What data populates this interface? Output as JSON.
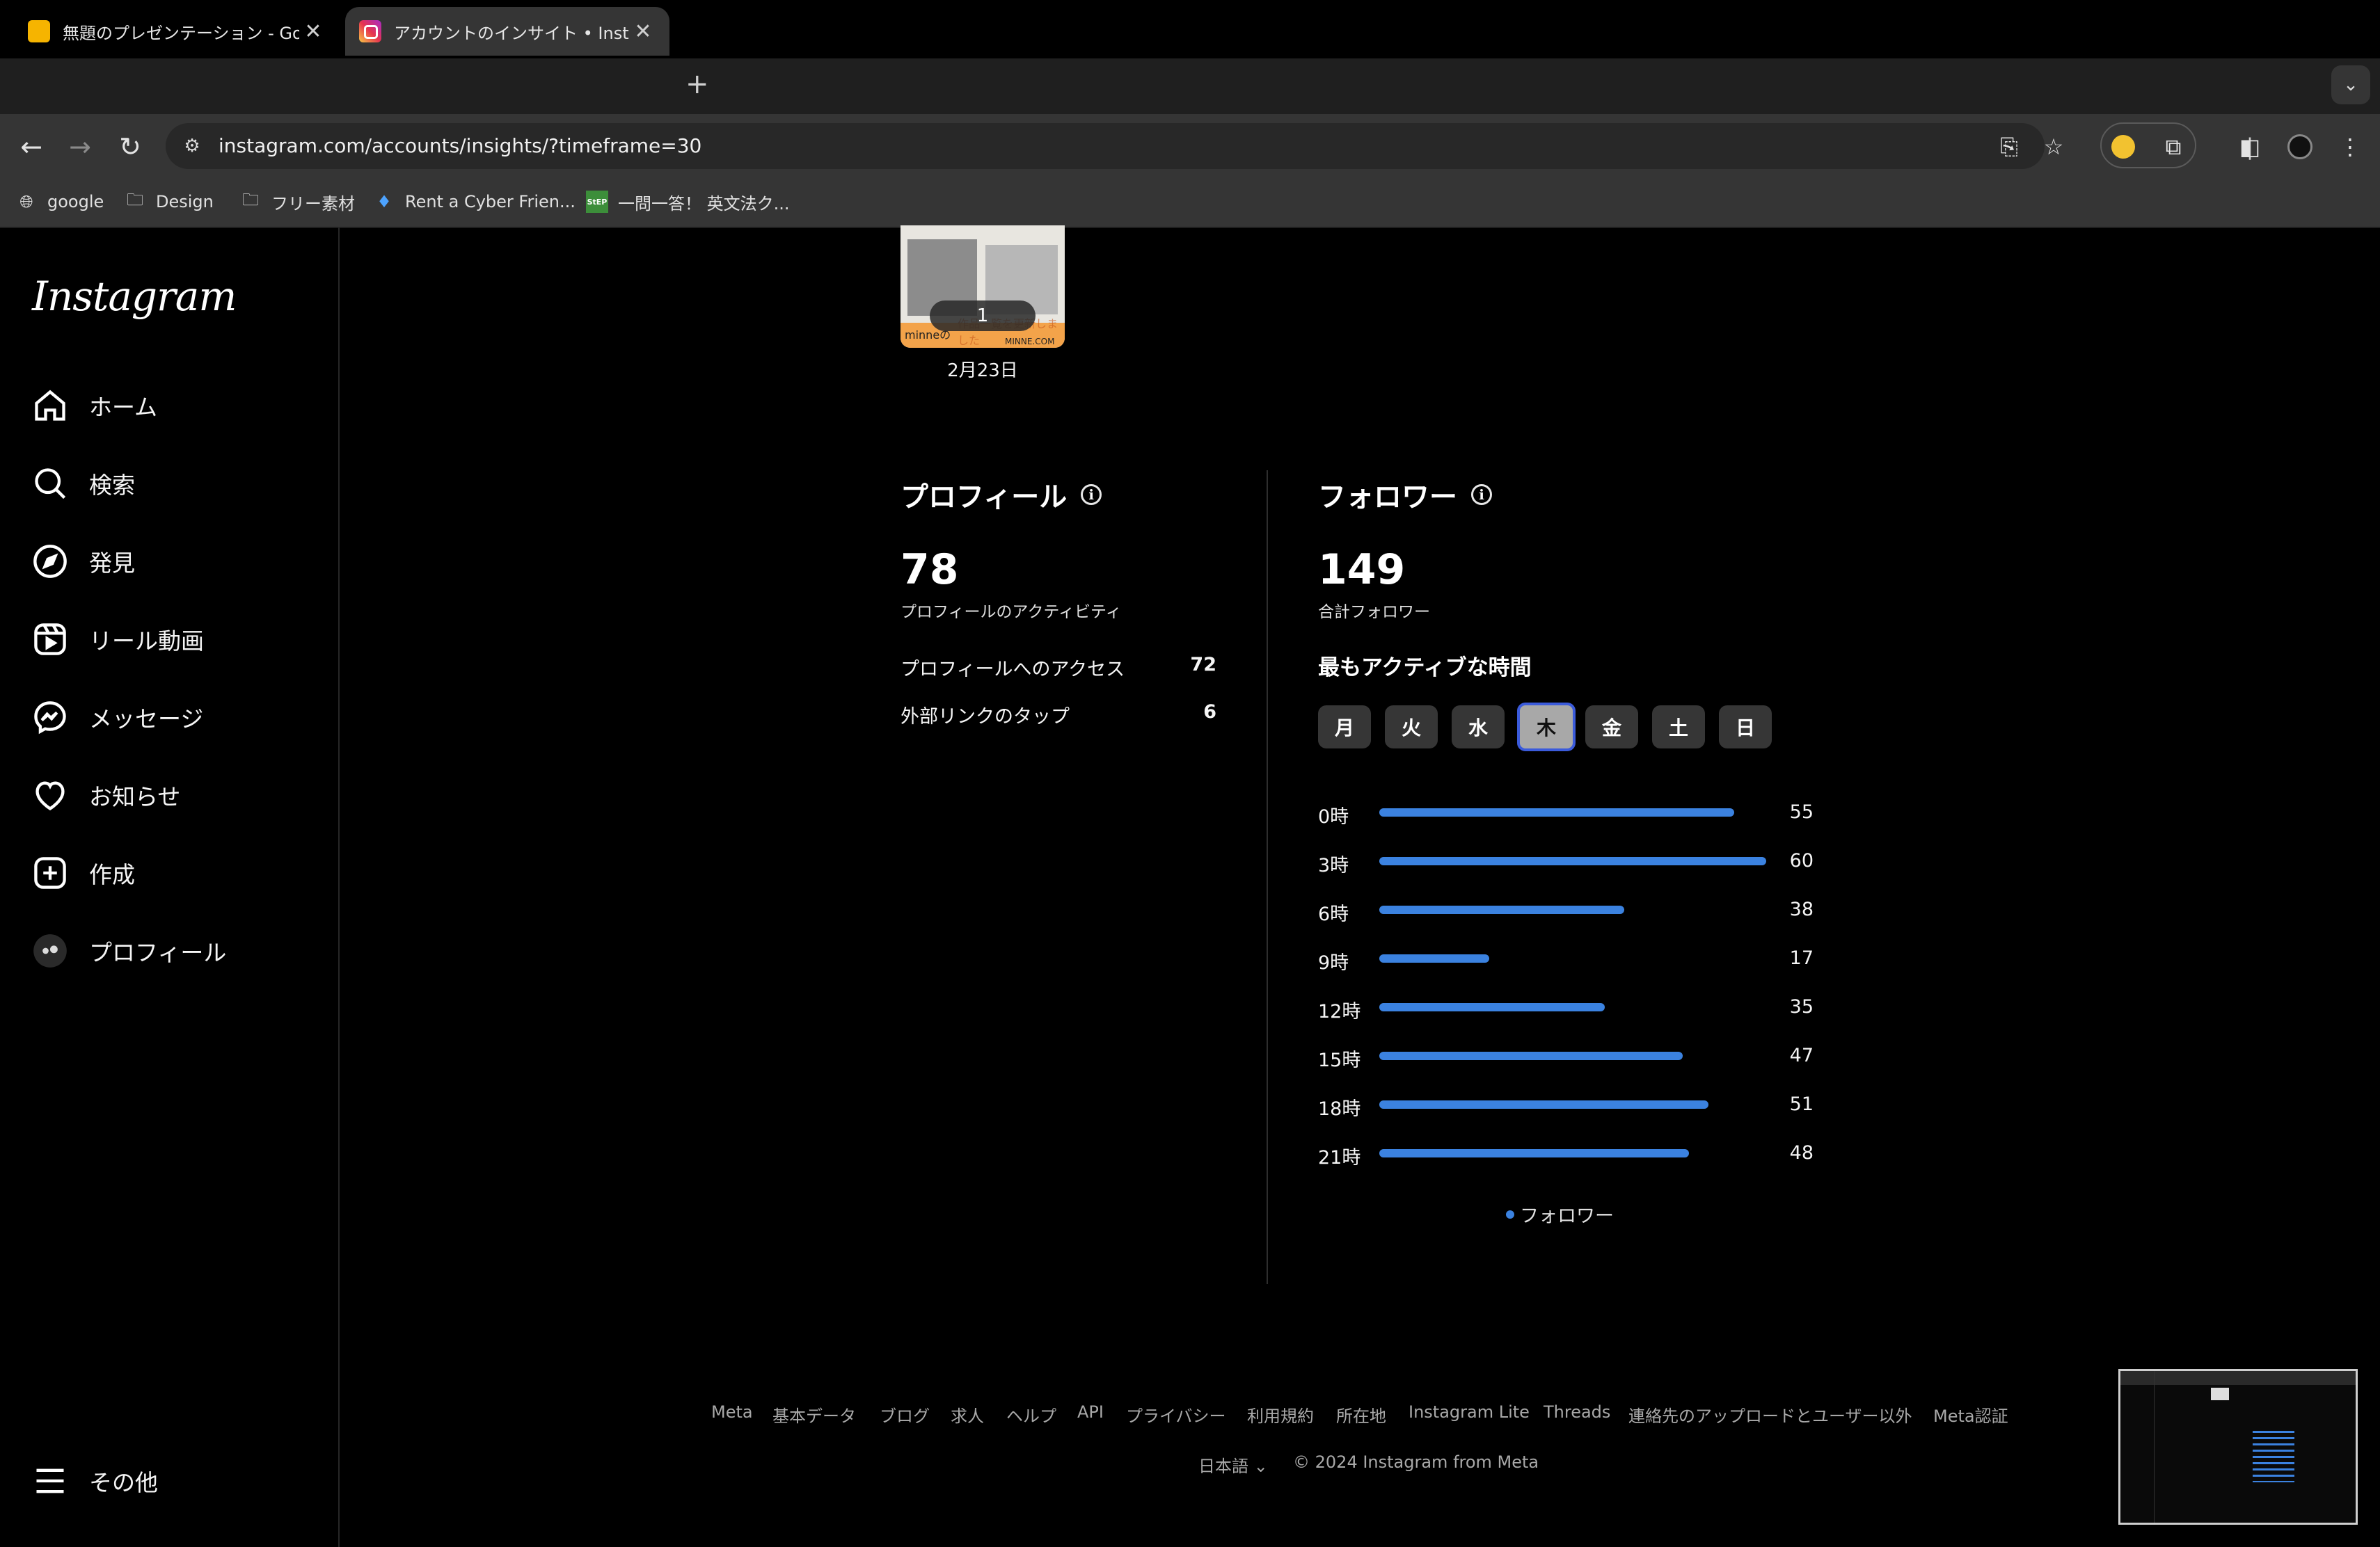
{
  "browser": {
    "tabs": [
      {
        "title": "無題のプレゼンテーション - Goo",
        "active": false
      },
      {
        "title": "アカウントのインサイト • Instag",
        "active": true
      }
    ],
    "url": "instagram.com/accounts/insights/?timeframe=30",
    "bookmarks": [
      "google",
      "Design",
      "フリー素材",
      "Rent a Cyber Frien...",
      "一問一答！ 英文法ク..."
    ],
    "bookmark_badge": "StEP"
  },
  "sidebar": {
    "logo": "Instagram",
    "items": [
      {
        "label": "ホーム",
        "icon": "home-icon"
      },
      {
        "label": "検索",
        "icon": "search-icon"
      },
      {
        "label": "発見",
        "icon": "compass-icon"
      },
      {
        "label": "リール動画",
        "icon": "reels-icon"
      },
      {
        "label": "メッセージ",
        "icon": "messenger-icon"
      },
      {
        "label": "お知らせ",
        "icon": "heart-icon"
      },
      {
        "label": "作成",
        "icon": "plus-square-icon"
      },
      {
        "label": "プロフィール",
        "icon": "avatar"
      }
    ],
    "more_label": "その他"
  },
  "post": {
    "count": "1",
    "date": "2月23日",
    "thumb_caption": "minneの",
    "thumb_caption2": "MINNE.COM",
    "thumb_overlay": "作品一覧を更新しました"
  },
  "profile": {
    "title": "プロフィール",
    "total": "78",
    "total_label": "プロフィールのアクティビティ",
    "rows": [
      {
        "label": "プロフィールへのアクセス",
        "value": "72"
      },
      {
        "label": "外部リンクのタップ",
        "value": "6"
      }
    ]
  },
  "followers": {
    "title": "フォロワー",
    "total": "149",
    "total_label": "合計フォロワー",
    "active_title": "最もアクティブな時間",
    "days": [
      "月",
      "火",
      "水",
      "木",
      "金",
      "土",
      "日"
    ],
    "selected_day": "木",
    "legend": "フォロワー"
  },
  "chart_data": {
    "type": "bar",
    "orientation": "horizontal",
    "categories": [
      "0時",
      "3時",
      "6時",
      "9時",
      "12時",
      "15時",
      "18時",
      "21時"
    ],
    "series": [
      {
        "name": "フォロワー",
        "values": [
          55,
          60,
          38,
          17,
          35,
          47,
          51,
          48
        ]
      }
    ],
    "xlim": [
      0,
      60
    ],
    "color": "#3b82e0",
    "grid": false,
    "legend_position": "bottom-center"
  },
  "footer": {
    "links": [
      "Meta",
      "基本データ",
      "ブログ",
      "求人",
      "ヘルプ",
      "API",
      "プライバシー",
      "利用規約",
      "所在地",
      "Instagram Lite",
      "Threads",
      "連絡先のアップロードとユーザー以外",
      "Meta認証"
    ],
    "language": "日本語",
    "copyright": "© 2024 Instagram from Meta"
  }
}
